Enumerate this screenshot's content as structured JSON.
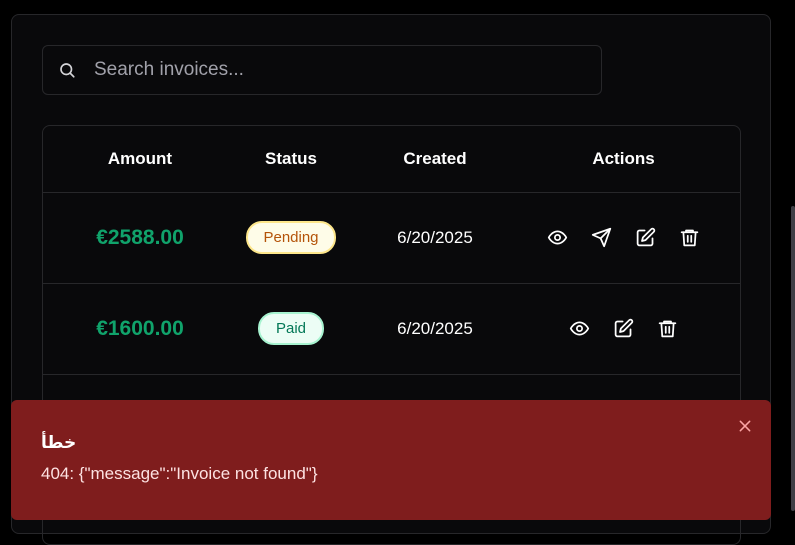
{
  "search": {
    "placeholder": "Search invoices..."
  },
  "table": {
    "columns": [
      "Amount",
      "Status",
      "Created",
      "Actions"
    ],
    "rows": [
      {
        "amount": "€2588.00",
        "status": "Pending",
        "created": "6/20/2025",
        "actions": [
          "view-icon",
          "send-icon",
          "edit-icon",
          "delete-icon"
        ]
      },
      {
        "amount": "€1600.00",
        "status": "Paid",
        "created": "6/20/2025",
        "actions": [
          "view-icon",
          "edit-icon",
          "delete-icon"
        ]
      }
    ]
  },
  "toast": {
    "title": "خطأ",
    "message": "404: {\"message\":\"Invoice not found\"}",
    "close_icon": "close-icon"
  },
  "colors": {
    "amount": "#10a36b",
    "pending_bg": "#fefce8",
    "pending_text": "#b45309",
    "paid_bg": "#ecfdf5",
    "paid_text": "#047857",
    "toast_bg": "#7f1d1d"
  }
}
